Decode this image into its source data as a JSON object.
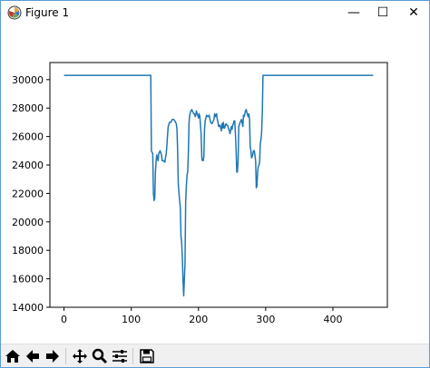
{
  "window": {
    "title": "Figure 1",
    "controls": {
      "minimize": "—",
      "maximize": "☐",
      "close": "✕"
    }
  },
  "toolbar": {
    "buttons": [
      {
        "name": "home-button",
        "icon": "home-icon"
      },
      {
        "name": "back-button",
        "icon": "arrow-left-icon"
      },
      {
        "name": "forward-button",
        "icon": "arrow-right-icon"
      },
      {
        "name": "pan-button",
        "icon": "move-icon"
      },
      {
        "name": "zoom-button",
        "icon": "magnifier-icon"
      },
      {
        "name": "configure-subplots-button",
        "icon": "sliders-icon"
      },
      {
        "name": "save-button",
        "icon": "floppy-disk-icon"
      }
    ]
  },
  "chart_data": {
    "type": "line",
    "title": "",
    "xlabel": "",
    "ylabel": "",
    "xlim": [
      -21,
      481
    ],
    "ylim": [
      14000,
      31200
    ],
    "xticks": [
      0,
      100,
      200,
      300,
      400
    ],
    "yticks": [
      14000,
      16000,
      18000,
      20000,
      22000,
      24000,
      26000,
      28000,
      30000
    ],
    "grid": false,
    "line_color": "#1f77b4",
    "series": [
      {
        "x": [
          0,
          129,
          130,
          131,
          132,
          133,
          134,
          135,
          136,
          137,
          138,
          140,
          141,
          143,
          145,
          146,
          148,
          150,
          152,
          153,
          154,
          155,
          157,
          159,
          161,
          163,
          165,
          167,
          168,
          169,
          170,
          172,
          173,
          174,
          175,
          176,
          177,
          178,
          180,
          181,
          182,
          183,
          184,
          185,
          186,
          187,
          188,
          189,
          190,
          192,
          193,
          194,
          195,
          196,
          197,
          198,
          199,
          200,
          201,
          202,
          203,
          204,
          205,
          206,
          207,
          208,
          209,
          210,
          212,
          214,
          216,
          218,
          220,
          222,
          223,
          224,
          225,
          227,
          228,
          229,
          230,
          232,
          234,
          235,
          236,
          237,
          238,
          239,
          240,
          241,
          242,
          243,
          244,
          245,
          246,
          247,
          248,
          249,
          250,
          251,
          252,
          253,
          254,
          255,
          256,
          257,
          258,
          259,
          260,
          262,
          264,
          266,
          267,
          268,
          269,
          270,
          271,
          272,
          273,
          274,
          275,
          276,
          277,
          278,
          279,
          280,
          282,
          283,
          284,
          285,
          286,
          287,
          288,
          289,
          290,
          291,
          292,
          293,
          294,
          295,
          296,
          297,
          298,
          460
        ],
        "y": [
          30300,
          30300,
          25000,
          24900,
          24800,
          22000,
          21500,
          21700,
          23500,
          24300,
          24700,
          24300,
          24800,
          25000,
          24700,
          24300,
          24300,
          24200,
          24800,
          25300,
          26100,
          26700,
          27000,
          27000,
          27200,
          27200,
          27100,
          26900,
          26500,
          25000,
          22700,
          21500,
          21000,
          19000,
          18600,
          17500,
          16000,
          14800,
          17000,
          21500,
          22500,
          23300,
          23500,
          25000,
          27000,
          27500,
          27700,
          27800,
          27900,
          27700,
          27600,
          27600,
          27400,
          27500,
          27800,
          27600,
          27500,
          27300,
          27600,
          27400,
          26800,
          26200,
          24500,
          24300,
          24300,
          24600,
          26500,
          27100,
          27500,
          27400,
          27500,
          27000,
          26900,
          27100,
          27200,
          27600,
          27400,
          27600,
          27200,
          27000,
          26700,
          26800,
          26400,
          26900,
          26600,
          27000,
          26600,
          26600,
          26800,
          26900,
          26800,
          26800,
          26700,
          26500,
          26400,
          26200,
          26500,
          26700,
          26500,
          26800,
          26900,
          27100,
          27100,
          26200,
          25000,
          23500,
          23500,
          24400,
          26700,
          27000,
          27200,
          26700,
          27500,
          27400,
          27600,
          27800,
          27900,
          27700,
          27500,
          27400,
          27600,
          27200,
          25300,
          25000,
          24500,
          24600,
          25000,
          25000,
          24700,
          24300,
          22400,
          22500,
          23500,
          23900,
          24000,
          24200,
          25500,
          25800,
          26300,
          27800,
          30300,
          30300,
          30300,
          30300
        ]
      }
    ]
  }
}
